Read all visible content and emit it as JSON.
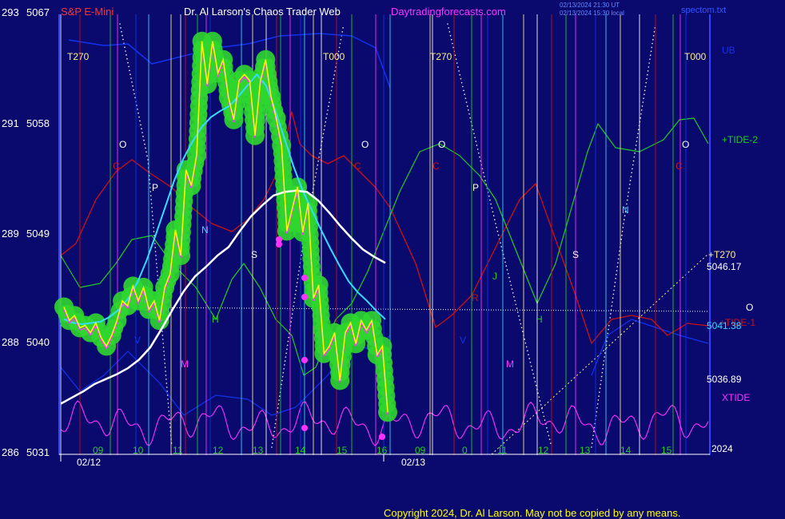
{
  "header": {
    "instrument": "S&P E-Mini",
    "title": "Dr. Al Larson's Chaos Trader Web",
    "site": "Daytradingforecasts.com",
    "stamp_ut": "02/13/2024 21:30 UT",
    "stamp_local": "02/13/2024 15:30 local",
    "data_file": "spectom.txt"
  },
  "footer": {
    "copyright": "Copyright 2024, Dr. Al Larson. May not be copied by any means."
  },
  "colors": {
    "background": "#0a0a6e",
    "price_bar": "#ffff00",
    "price_glow": "#2fd62f",
    "magenta": "#ff33ff",
    "cyan": "#33ddff",
    "white": "#ffffff",
    "red": "#cc1111",
    "green": "#22cc22",
    "blue": "#1133ee",
    "header_red": "#ff3333",
    "header_magenta": "#ff33ff"
  },
  "chart_data": {
    "type": "line",
    "title": "S&P E-Mini",
    "y_left_labels": [
      "293",
      "291",
      "289",
      "288",
      "286"
    ],
    "y_right_labels": [
      "5067",
      "5058",
      "5049",
      "5040",
      "5031"
    ],
    "ylim": [
      5031,
      5067
    ],
    "x_hour_labels": [
      "09",
      "10",
      "11",
      "12",
      "13",
      "14",
      "15",
      "16",
      "09",
      "0",
      "11",
      "12",
      "13",
      "14",
      "15"
    ],
    "x_date_labels": [
      "02/12",
      "02/13"
    ],
    "x_year_label": "2024",
    "series_labels": {
      "ub": "UB",
      "tide2": "+TIDE-2",
      "t270": "+T270",
      "tide1": "+TIDE-1",
      "xtide": "XTIDE"
    },
    "value_labels": [
      "5046.17",
      "5041.38",
      "5036.89"
    ],
    "top_markers": [
      "T270",
      "T000",
      "T270",
      "T000"
    ],
    "letter_markers": [
      "O",
      "C",
      "P",
      "N",
      "S",
      "J",
      "H",
      "M",
      "V",
      "O",
      "C",
      "O",
      "C",
      "P",
      "N",
      "S",
      "J",
      "H",
      "M",
      "V",
      "O",
      "C",
      "R",
      "O"
    ],
    "price": [
      5043.1,
      5042.0,
      5042.4,
      5041.4,
      5041.6,
      5041.0,
      5041.8,
      5040.6,
      5039.9,
      5040.8,
      5042.0,
      5043.6,
      5043.2,
      5044.8,
      5043.6,
      5044.7,
      5042.9,
      5043.6,
      5042.0,
      5044.7,
      5045.8,
      5049.4,
      5047.3,
      5054.3,
      5053.0,
      5055.5,
      5064.8,
      5061.3,
      5064.8,
      5062.2,
      5063.3,
      5060.2,
      5058.4,
      5061.6,
      5062.1,
      5061.6,
      5057.1,
      5061.5,
      5063.3,
      5060.3,
      5058.5,
      5056.3,
      5049.3,
      5051.1,
      5052.9,
      5049.2,
      5051.6,
      5043.8,
      5044.9,
      5039.3,
      5039.9,
      5041.0,
      5037.1,
      5041.0,
      5041.8,
      5040.1,
      5042.0,
      5041.2,
      5042.0,
      5039.2,
      5039.9,
      5034.5
    ],
    "avg_cyan": [
      5042.1,
      5041.8,
      5041.7,
      5041.8,
      5041.9,
      5042.3,
      5042.9,
      5043.8,
      5045.1,
      5046.9,
      5049.0,
      5051.2,
      5053.4,
      5055.2,
      5056.6,
      5057.8,
      5058.6,
      5059.1,
      5059.5,
      5060.3,
      5061.2,
      5062.1,
      5061.2,
      5059.2,
      5056.9,
      5054.6,
      5052.6,
      5051.0,
      5049.4,
      5047.9,
      5046.5,
      5045.2,
      5044.3,
      5043.6,
      5042.8,
      5042.1
    ],
    "avg_white": [
      5035.2,
      5035.7,
      5036.2,
      5036.8,
      5037.2,
      5037.6,
      5038.1,
      5038.8,
      5039.8,
      5041.3,
      5042.9,
      5044.4,
      5045.6,
      5046.4,
      5047.3,
      5048.0,
      5049.3,
      5050.5,
      5051.4,
      5052.2,
      5052.5,
      5052.6,
      5052.5,
      5051.8,
      5050.8,
      5049.7,
      5048.7,
      5047.8,
      5047.2,
      5046.7
    ]
  }
}
